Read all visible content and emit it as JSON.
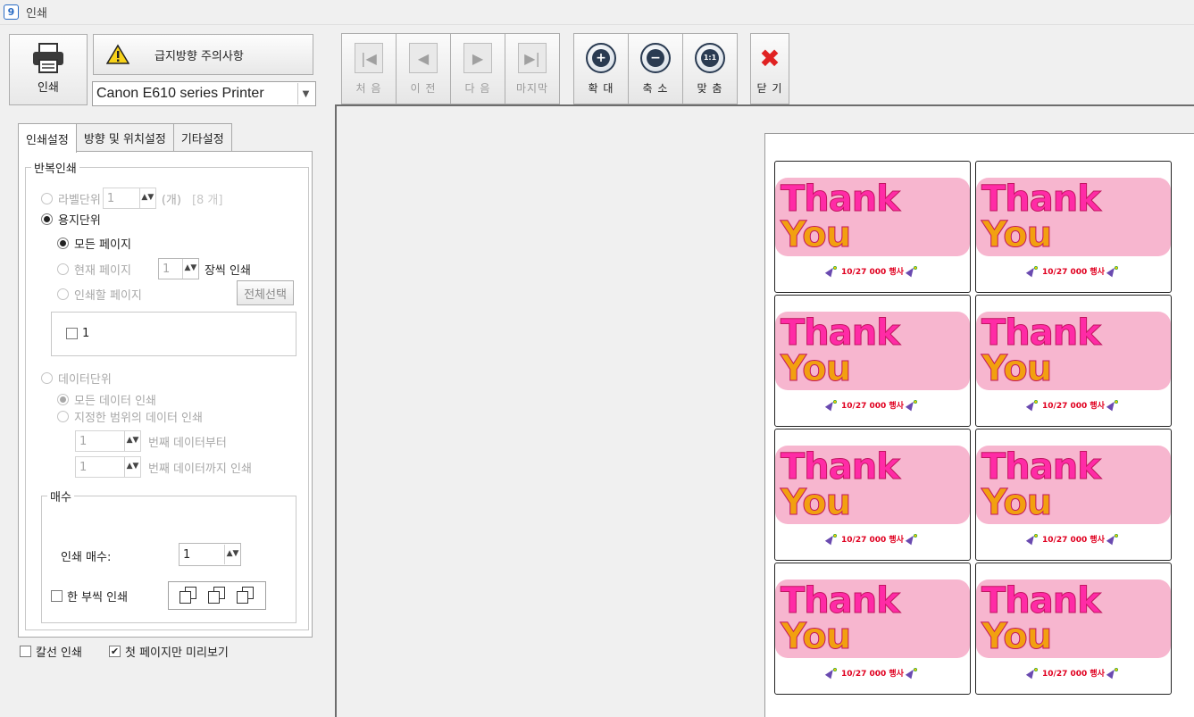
{
  "window": {
    "title": "인쇄",
    "icon": "printer-app-icon"
  },
  "top": {
    "print_label": "인쇄",
    "warning_label": "급지방향 주의사항",
    "printer": "Canon E610 series Printer"
  },
  "tabs": [
    "인쇄설정",
    "방향 및 위치설정",
    "기타설정"
  ],
  "repeat": {
    "legend": "반복인쇄",
    "label_unit": "라벨단위",
    "label_unit_value": "1",
    "label_unit_suffix": "(개)",
    "label_count": "[8 개]",
    "paper_unit": "용지단위",
    "all_pages": "모든 페이지",
    "current_page": "현재 페이지",
    "current_page_value": "1",
    "per_sheet": "장씩 인쇄",
    "pages_to_print": "인쇄할 페이지",
    "select_all": "전체선택",
    "page_item": "1",
    "data_unit": "데이터단위",
    "all_data": "모든 데이터 인쇄",
    "range_data": "지정한 범위의 데이터 인쇄",
    "from_value": "1",
    "from_label": "번째 데이터부터",
    "to_value": "1",
    "to_label": "번째 데이터까지 인쇄"
  },
  "copies": {
    "legend": "매수",
    "count_label": "인쇄 매수:",
    "count_value": "1",
    "collate_label": "한 부씩 인쇄"
  },
  "bottom": {
    "cut_line": "칼선 인쇄",
    "first_page_preview": "첫 페이지만 미리보기",
    "first_page_checked": "✔"
  },
  "toolbar": {
    "first": "처 음",
    "prev": "이 전",
    "next": "다 음",
    "last": "마지막",
    "zoom_in": "확 대",
    "zoom_out": "축 소",
    "fit": "맞 춤",
    "fit_icon_text": "1:1",
    "close": "닫 기"
  },
  "label": {
    "text_thank": "Thank",
    "text_you": "You",
    "subtitle": "10/27 000 행사"
  },
  "colors": {
    "accent": "#2a6cc4",
    "close_red": "#e02222"
  }
}
